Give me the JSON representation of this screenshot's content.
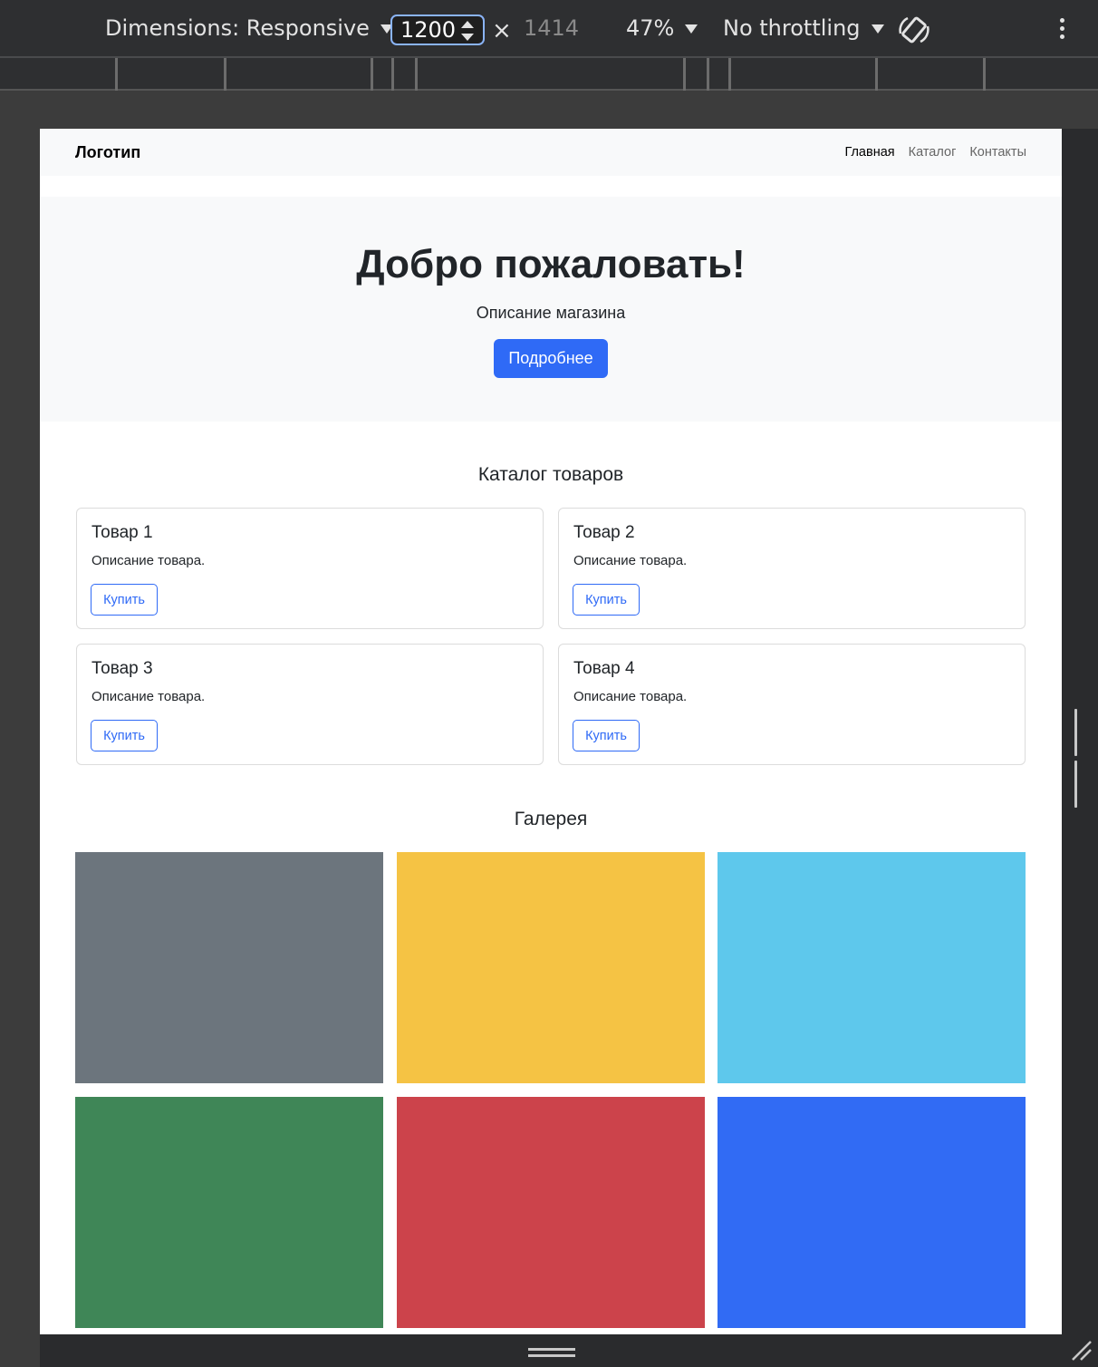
{
  "devtools": {
    "dimensions_label": "Dimensions: Responsive",
    "width_value": "1200",
    "height_value": "1414",
    "times_symbol": "×",
    "zoom": "47%",
    "throttling": "No throttling"
  },
  "site": {
    "brand": "Логотип",
    "nav": [
      {
        "label": "Главная",
        "active": true
      },
      {
        "label": "Каталог",
        "active": false
      },
      {
        "label": "Контакты",
        "active": false
      }
    ],
    "hero": {
      "title": "Добро пожаловать!",
      "subtitle": "Описание магазина",
      "button": "Подробнее"
    },
    "catalog": {
      "title": "Каталог товаров",
      "products": [
        {
          "title": "Товар 1",
          "text": "Описание товара.",
          "button": "Купить"
        },
        {
          "title": "Товар 2",
          "text": "Описание товара.",
          "button": "Купить"
        },
        {
          "title": "Товар 3",
          "text": "Описание товара.",
          "button": "Купить"
        },
        {
          "title": "Товар 4",
          "text": "Описание товара.",
          "button": "Купить"
        }
      ]
    },
    "gallery": {
      "title": "Галерея",
      "colors": [
        "#6c757d",
        "#f5c344",
        "#5ec8ec",
        "#3f8657",
        "#cc434b",
        "#316bf4"
      ]
    }
  }
}
